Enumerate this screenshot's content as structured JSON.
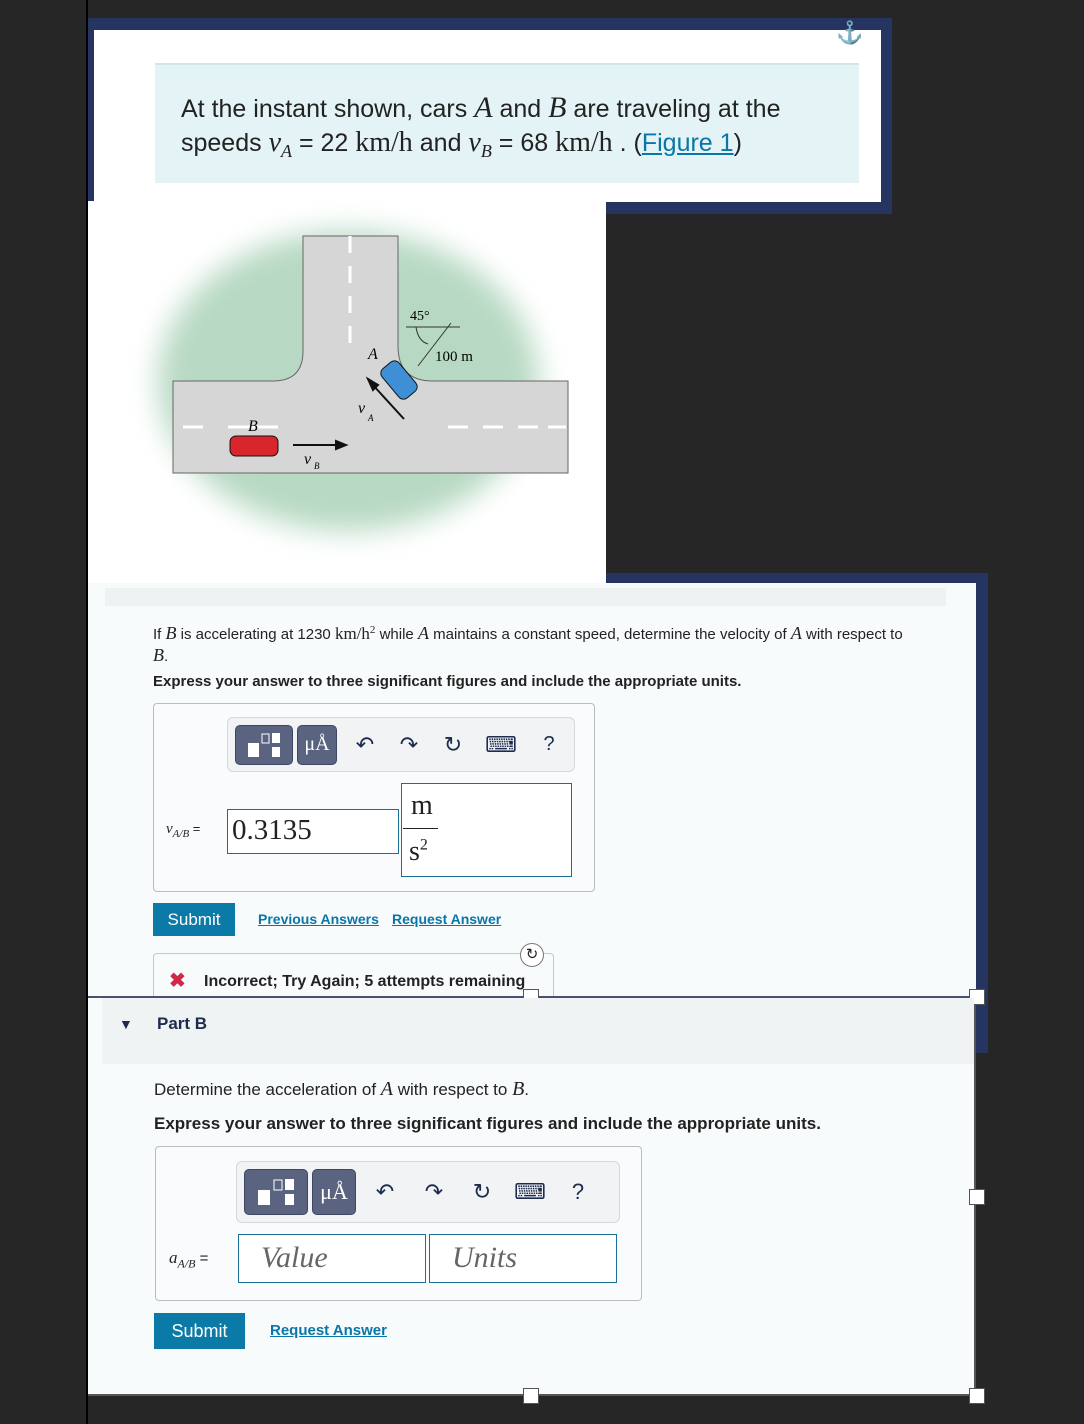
{
  "problem": {
    "intro_line1_pre": "At the instant shown, cars ",
    "car_a": "A",
    "and": " and ",
    "car_b": "B",
    "intro_line1_post": " are traveling at the",
    "line2_pre": "speeds ",
    "va_sym": "v",
    "va_sub": "A",
    "va_val": " = 22 ",
    "unit_kmh": "km/h",
    "and2": " and ",
    "vb_sym": "v",
    "vb_sub": "B",
    "vb_val": " = 68 ",
    "dot": " . (",
    "figure_link": "Figure 1",
    "close": ")"
  },
  "figure": {
    "label_angle": "45°",
    "label_distance": "100 m",
    "label_a": "A",
    "label_b": "B",
    "label_va": "v",
    "label_va_sub": "A",
    "label_vb": "v",
    "label_vb_sub": "B",
    "colors": {
      "grass": "#b7d9c3",
      "road": "#d6d6d6",
      "car_a": "#3f8fd6",
      "car_b": "#d9262c"
    }
  },
  "part_a": {
    "q_pre": "If ",
    "q_b": "B",
    "q_mid1": " is accelerating at 1230 ",
    "q_unit": "km/h",
    "q_unit_sup": "2",
    "q_mid2": " while ",
    "q_a": "A",
    "q_mid3": " maintains a constant speed, determine the velocity of ",
    "q_a2": "A",
    "q_mid4": " with respect to",
    "q_b2": "B",
    "q_end": ".",
    "instruction": "Express your answer to three significant figures and include the appropriate units.",
    "toolbar": {
      "templates": "templates-icon",
      "units_label": "μÅ",
      "undo": "↶",
      "redo": "↷",
      "reset": "↻",
      "keyboard": "⌨",
      "help": "?"
    },
    "var_sym": "v",
    "var_sub": "A/B",
    "equals": " =",
    "value": "0.3135",
    "unit_num": "m",
    "unit_den": "s",
    "unit_den_sup": "2",
    "submit": "Submit",
    "previous_answers": "Previous Answers",
    "request_answer": "Request Answer",
    "feedback": "Incorrect; Try Again; 5 attempts remaining"
  },
  "part_b": {
    "title": "Part B",
    "q_pre": "Determine the acceleration of ",
    "q_a": "A",
    "q_mid": " with respect to ",
    "q_b": "B",
    "q_end": ".",
    "instruction": "Express your answer to three significant figures and include the appropriate units.",
    "toolbar": {
      "units_label": "μÅ",
      "undo": "↶",
      "redo": "↷",
      "reset": "↻",
      "keyboard": "⌨",
      "help": "?"
    },
    "var_sym": "a",
    "var_sub": "A/B",
    "equals": " =",
    "value_placeholder": "Value",
    "units_placeholder": "Units",
    "submit": "Submit",
    "request_answer": "Request Answer"
  },
  "anchor_icon": "⚓"
}
